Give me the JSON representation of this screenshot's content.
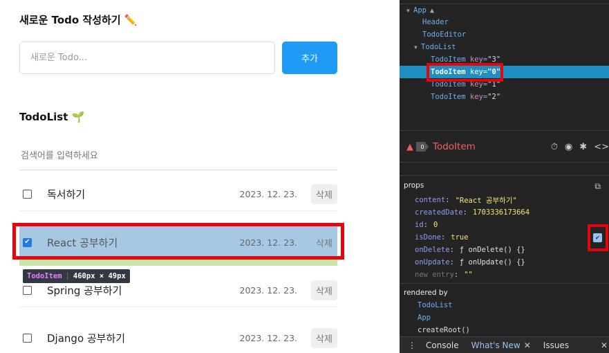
{
  "app": {
    "editor_title": "새로운 Todo 작성하기 ✏️",
    "new_placeholder": "새로운 Todo...",
    "add_label": "추가",
    "list_title": "TodoList 🌱",
    "search_placeholder": "검색어를 입력하세요",
    "delete_label": "삭제",
    "items": [
      {
        "content": "독서하기",
        "date": "2023. 12. 23.",
        "done": false
      },
      {
        "content": "React 공부하기",
        "date": "2023. 12. 23.",
        "done": true
      },
      {
        "content": "Spring 공부하기",
        "date": "2023. 12. 23.",
        "done": false
      },
      {
        "content": "Django 공부하기",
        "date": "2023. 12. 23.",
        "done": false
      }
    ],
    "tooltip": {
      "name": "TodoItem",
      "size": "460px × 49px"
    }
  },
  "devtools": {
    "tree": {
      "app": "App",
      "header": "Header",
      "editor": "TodoEditor",
      "list": "TodoList",
      "item_name": "TodoItem",
      "key_attr": "key",
      "keys": [
        "\"3\"",
        "\"0\"",
        "\"1\"",
        "\"2\""
      ]
    },
    "selected": {
      "badge": "0",
      "name": "TodoItem"
    },
    "props_label": "props",
    "props": [
      {
        "key": "content",
        "value": "\"React 공부하기\""
      },
      {
        "key": "createdDate",
        "value": "1703336173664"
      },
      {
        "key": "id",
        "value": "0"
      },
      {
        "key": "isDone",
        "value": "true"
      },
      {
        "key": "onDelete",
        "value": "ƒ onDelete() {}"
      },
      {
        "key": "onUpdate",
        "value": "ƒ onUpdate() {}"
      },
      {
        "key": "new entry",
        "value": "\"\""
      }
    ],
    "rendered_by_label": "rendered by",
    "rendered_by": [
      "TodoList",
      "App",
      "createRoot()"
    ],
    "bottom_tabs": {
      "console": "Console",
      "whats_new": "What's New",
      "issues": "Issues"
    },
    "icons": [
      "timer-icon",
      "eye-icon",
      "bug-icon",
      "code-icon",
      "copy-icon"
    ]
  }
}
